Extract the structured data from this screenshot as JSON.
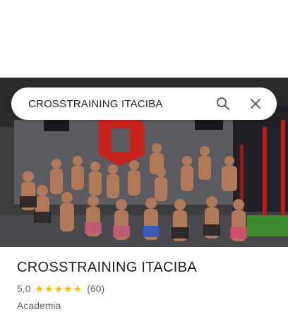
{
  "search": {
    "query": "CROSSTRAINING ITACIBA",
    "search_icon": "search-icon",
    "close_icon": "close-icon"
  },
  "place": {
    "name": "CROSSTRAINING ITACIBA",
    "rating": "5,0",
    "stars": 5,
    "review_count": "(60)",
    "category": "Academia"
  },
  "colors": {
    "star": "#fbbc04",
    "text_primary": "#202124",
    "text_secondary": "#5f6368",
    "logo_red": "#c8231e"
  }
}
